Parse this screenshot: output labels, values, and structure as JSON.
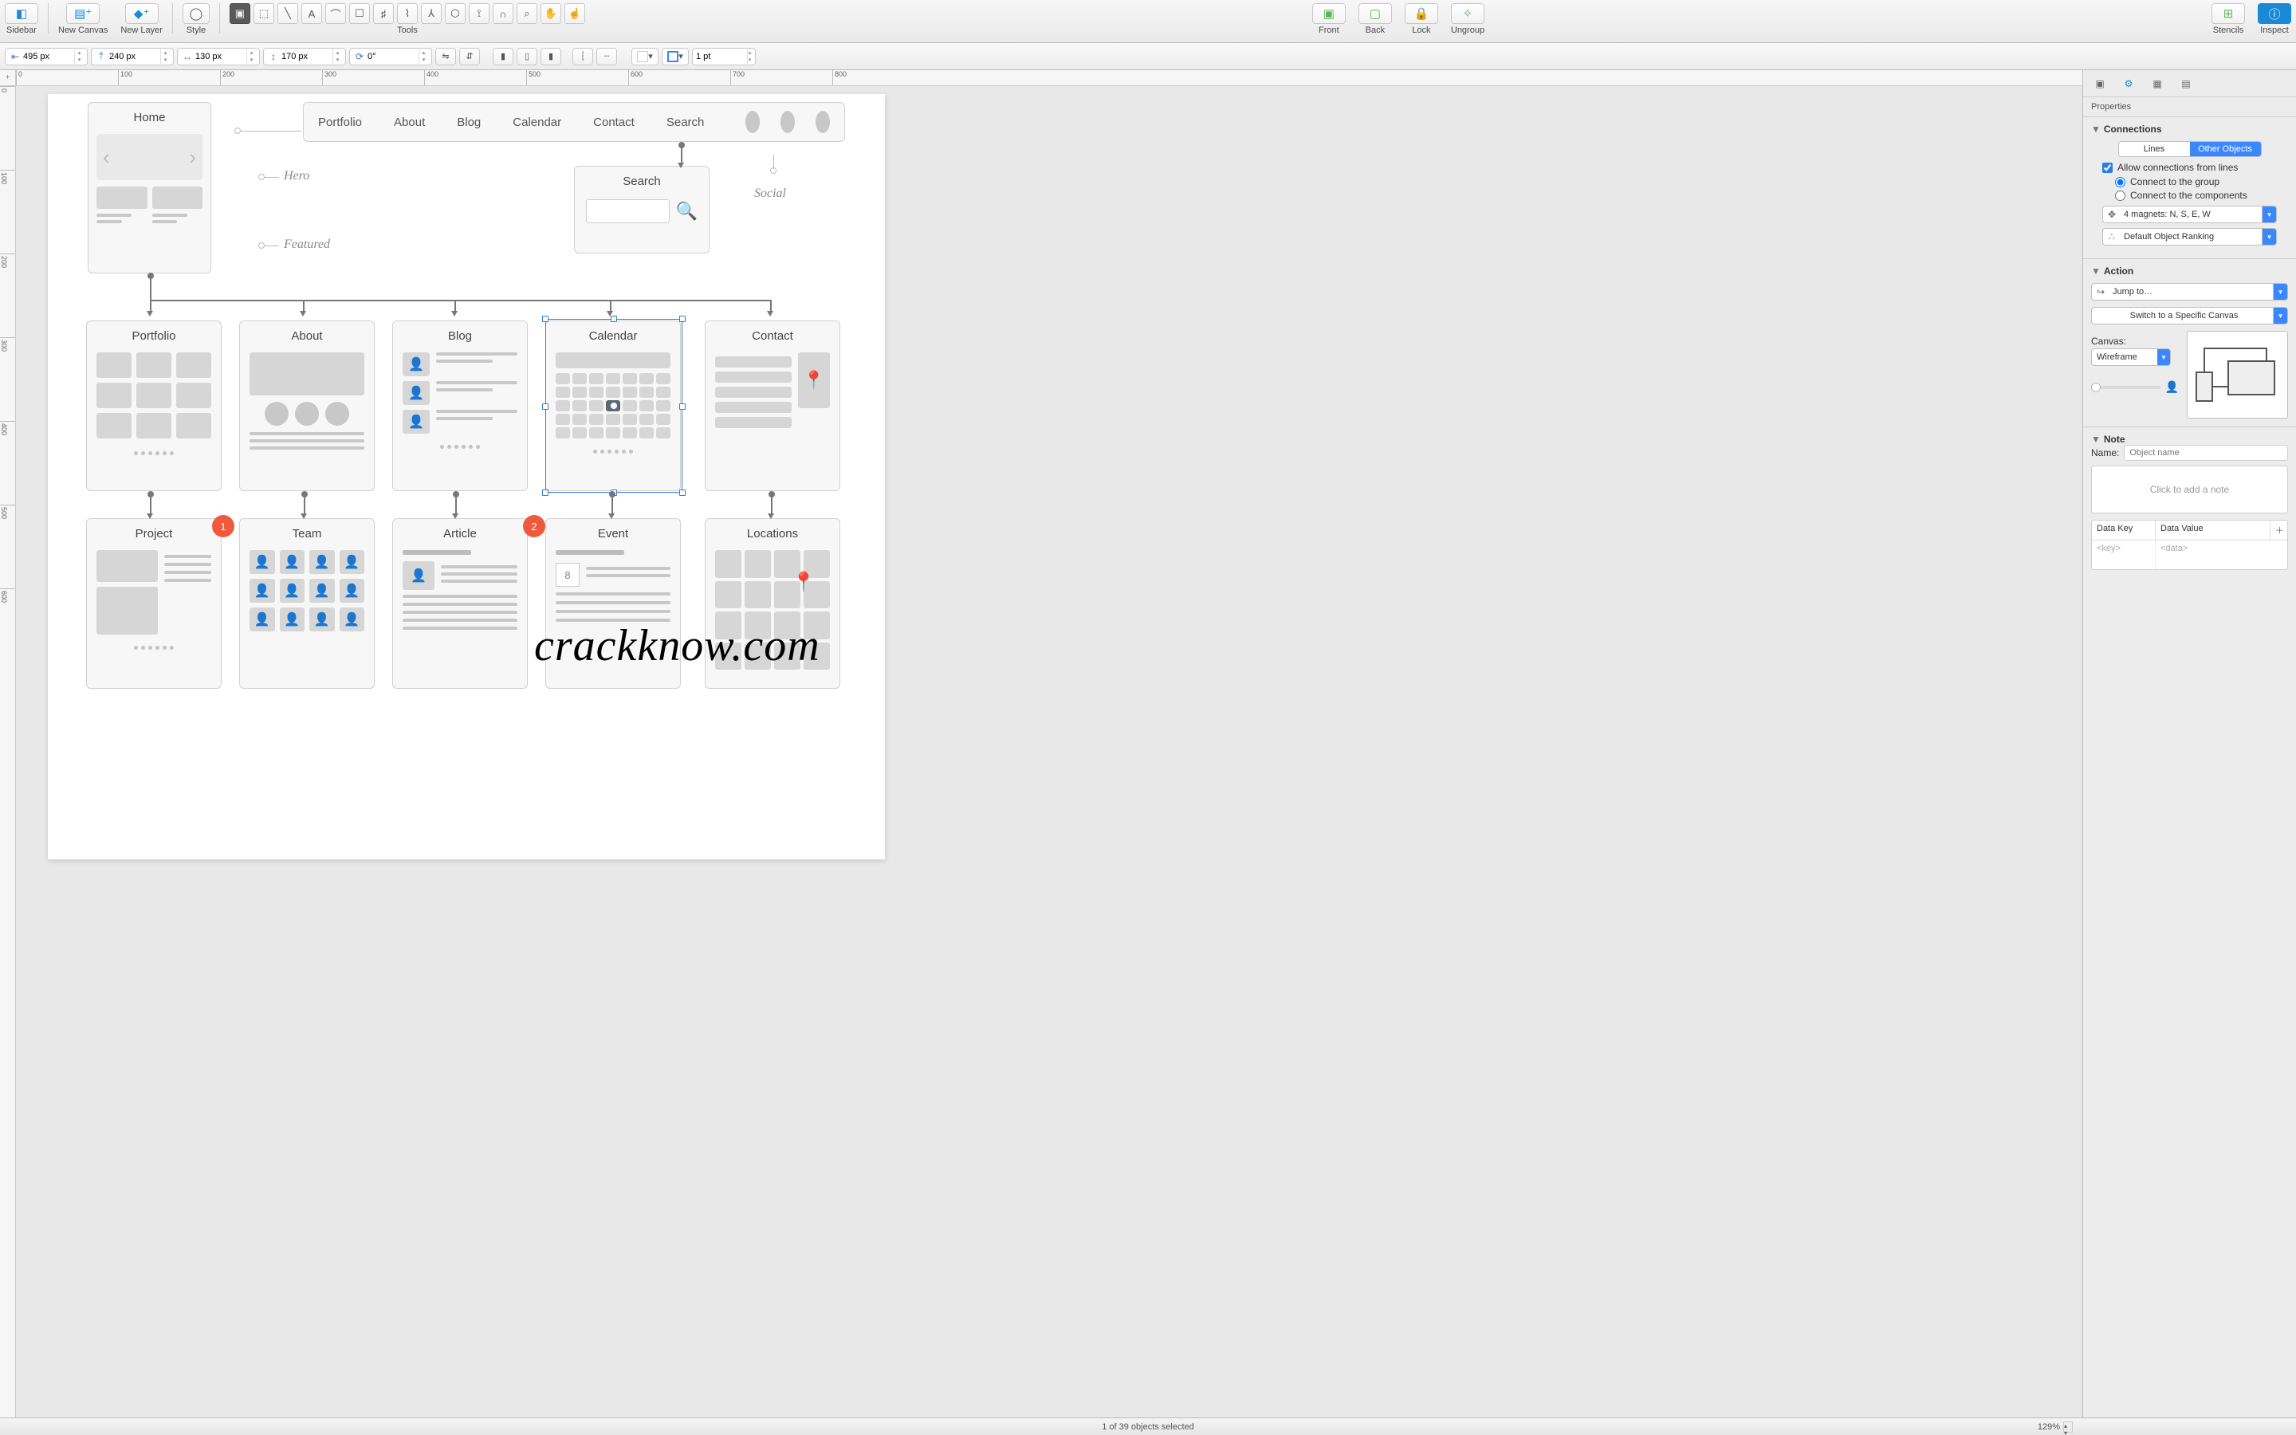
{
  "toolbar": {
    "sidebar": "Sidebar",
    "new_canvas": "New Canvas",
    "new_layer": "New Layer",
    "style": "Style",
    "tools": "Tools",
    "front": "Front",
    "back": "Back",
    "lock": "Lock",
    "ungroup": "Ungroup",
    "stencils": "Stencils",
    "inspect": "Inspect"
  },
  "tools_glyphs": [
    "▣",
    "⬚",
    "╲",
    "A",
    "⌒",
    "☐",
    "♯",
    "⌇",
    "⅄",
    "⬡",
    "⟟",
    "∩",
    "⌕",
    "✋",
    "☝"
  ],
  "measure": {
    "x": "495 px",
    "y": "240 px",
    "w": "130 px",
    "h": "170 px",
    "rot": "0°",
    "stroke": "1 pt"
  },
  "ruler_top": [
    "0",
    "100",
    "200",
    "300",
    "400",
    "500",
    "600",
    "700",
    "800"
  ],
  "ruler_left": [
    "0",
    "100",
    "200",
    "300",
    "400",
    "500",
    "600"
  ],
  "canvas": {
    "nav": [
      "Portfolio",
      "About",
      "Blog",
      "Calendar",
      "Contact",
      "Search"
    ],
    "home": "Home",
    "anno_hero": "Hero",
    "anno_featured": "Featured",
    "anno_social": "Social",
    "search_card": "Search",
    "row2": [
      "Portfolio",
      "About",
      "Blog",
      "Calendar",
      "Contact"
    ],
    "row3": [
      "Project",
      "Team",
      "Article",
      "Event",
      "Locations"
    ],
    "badge1": "1",
    "badge2": "2",
    "event_day": "8"
  },
  "watermark": "crackknow.com",
  "inspector": {
    "properties": "Properties",
    "sect_connections": "Connections",
    "seg_lines": "Lines",
    "seg_other": "Other Objects",
    "allow": "Allow connections from lines",
    "r_group": "Connect to the group",
    "r_comp": "Connect to the components",
    "magnets": "4 magnets: N, S, E, W",
    "ranking": "Default Object Ranking",
    "sect_action": "Action",
    "jump": "Jump to…",
    "switch": "Switch to a Specific Canvas",
    "canvas_lbl": "Canvas:",
    "canvas_val": "Wireframe",
    "sect_note": "Note",
    "name_lbl": "Name:",
    "name_ph": "Object name",
    "note_ph": "Click to add a note",
    "kv_key": "Data Key",
    "kv_val": "Data Value",
    "kv_krow": "<key>",
    "kv_vrow": "<data>"
  },
  "status": {
    "selection": "1 of 39 objects selected",
    "zoom": "129%"
  }
}
